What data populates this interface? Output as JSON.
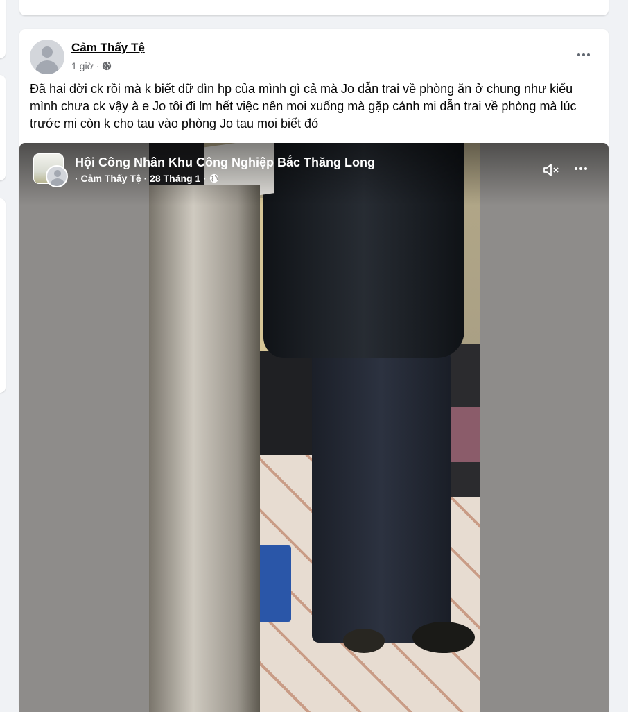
{
  "post": {
    "author": "Cảm Thấy Tệ",
    "time": "1 giờ",
    "separator": "·",
    "text": "Đã hai đời ck rồi mà k biết dữ dìn hp của mình gì cả mà Jo dẫn trai về phòng ăn ở chung như kiểu mình chưa ck vậy à e Jo tôi đi lm hết việc nên moi xuống mà gặp cảnh mi dẫn trai về phòng mà lúc trước mi còn k cho tau vào phòng Jo tau moi biết đó"
  },
  "shared_video": {
    "group_name": "Hội Công Nhân Khu Công Nghiệp Bắc Thăng Long",
    "meta_prefix": "· Cảm Thấy Tệ · 28 Tháng 1 ·"
  },
  "icons": {
    "more": "more-horizontal-icon",
    "globe": "globe-icon",
    "mute": "speaker-muted-icon"
  },
  "colors": {
    "page_bg": "#f0f2f5",
    "card_bg": "#ffffff",
    "secondary_text": "#65676b"
  }
}
